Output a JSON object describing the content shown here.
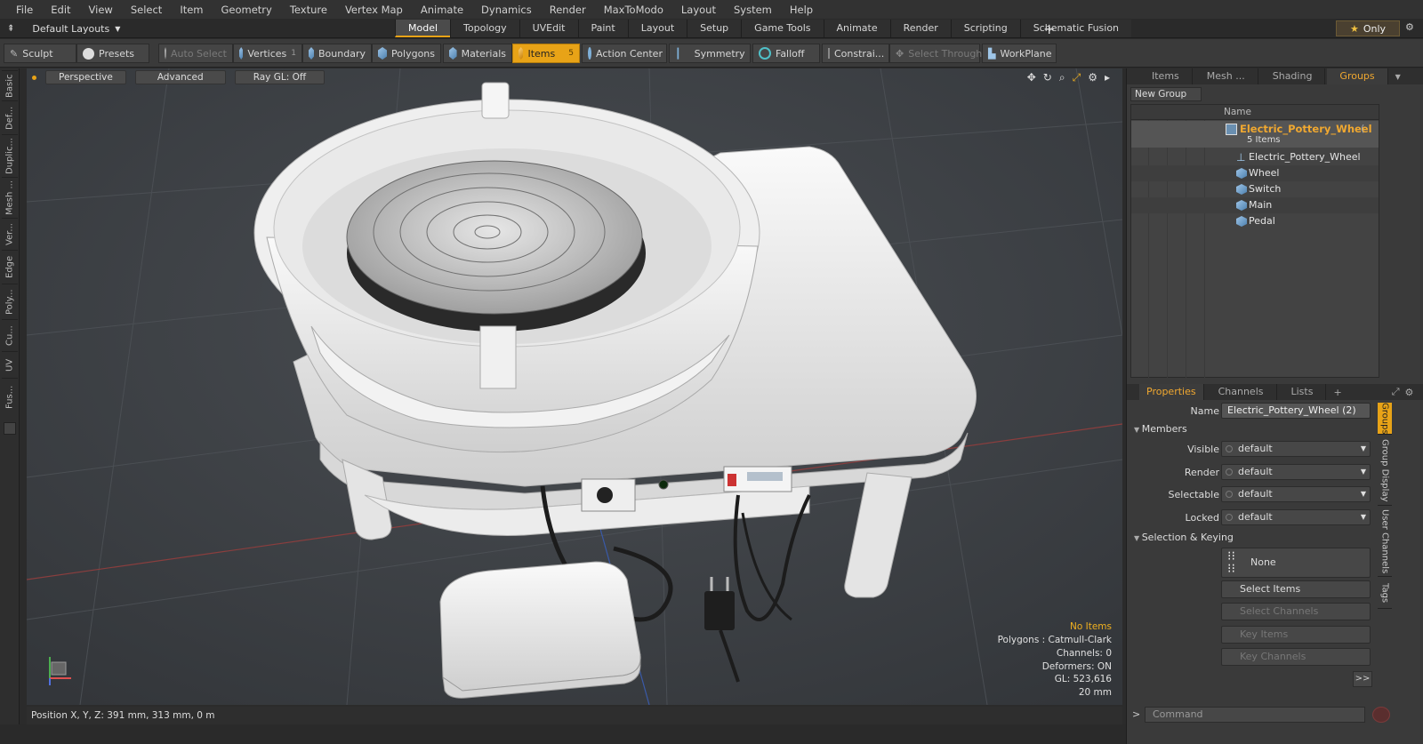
{
  "menu": [
    "File",
    "Edit",
    "View",
    "Select",
    "Item",
    "Geometry",
    "Texture",
    "Vertex Map",
    "Animate",
    "Dynamics",
    "Render",
    "MaxToModo",
    "Layout",
    "System",
    "Help"
  ],
  "layout_dropdown": "Default Layouts",
  "layout_tabs": [
    "Model",
    "Topology",
    "UVEdit",
    "Paint",
    "Layout",
    "Setup",
    "Game Tools",
    "Animate",
    "Render",
    "Scripting",
    "Schematic Fusion"
  ],
  "only_label": "Only",
  "toolbar": {
    "sculpt": "Sculpt",
    "presets": "Presets",
    "auto_select": "Auto Select",
    "vertices": "Vertices",
    "vertices_count": "1",
    "boundary": "Boundary",
    "polygons": "Polygons",
    "materials": "Materials",
    "items": "Items",
    "items_count": "5",
    "action_center": "Action Center",
    "symmetry": "Symmetry",
    "falloff": "Falloff",
    "constraints": "Constrai...",
    "select_through": "Select Through",
    "workplane": "WorkPlane"
  },
  "left_tabs": [
    "Basic",
    "Def...",
    "Duplic...",
    "Mesh ...",
    "Ver...",
    "Edge",
    "Poly...",
    "Cu...",
    "UV",
    "Fus..."
  ],
  "viewport": {
    "perspective": "Perspective",
    "advanced": "Advanced",
    "raygl": "Ray GL: Off",
    "info": {
      "selection": "No Items",
      "polygons": "Polygons : Catmull-Clark",
      "channels": "Channels: 0",
      "deformers": "Deformers: ON",
      "gl": "GL: 523,616",
      "scale": "20 mm"
    }
  },
  "status": "Position X, Y, Z:   391 mm, 313 mm, 0 m",
  "top_panel_tabs": [
    "Items",
    "Mesh ...",
    "Shading",
    "Groups"
  ],
  "new_group": "New Group",
  "tree": {
    "name_header": "Name",
    "group_name": "Electric_Pottery_Wheel",
    "group_suffix": "(",
    "group_count": "5 Items",
    "items": [
      "Electric_Pottery_Wheel",
      "Wheel",
      "Switch",
      "Main",
      "Pedal"
    ]
  },
  "prop_tabs": [
    "Properties",
    "Channels",
    "Lists"
  ],
  "properties": {
    "name_label": "Name",
    "name_value": "Electric_Pottery_Wheel (2)",
    "members": "Members",
    "visible_label": "Visible",
    "visible_value": "default",
    "render_label": "Render",
    "render_value": "default",
    "selectable_label": "Selectable",
    "selectable_value": "default",
    "locked_label": "Locked",
    "locked_value": "default",
    "sel_keying": "Selection & Keying",
    "none": "None",
    "select_items": "Select Items",
    "select_channels": "Select Channels",
    "key_items": "Key Items",
    "key_channels": "Key Channels"
  },
  "right_side_tabs": [
    "Groups",
    "Group Display",
    "User Channels",
    "Tags"
  ],
  "command_placeholder": "Command",
  "colors": {
    "accent": "#e8a317",
    "viewport_bg": "#3c3f43",
    "group_name": "#f0a830"
  }
}
